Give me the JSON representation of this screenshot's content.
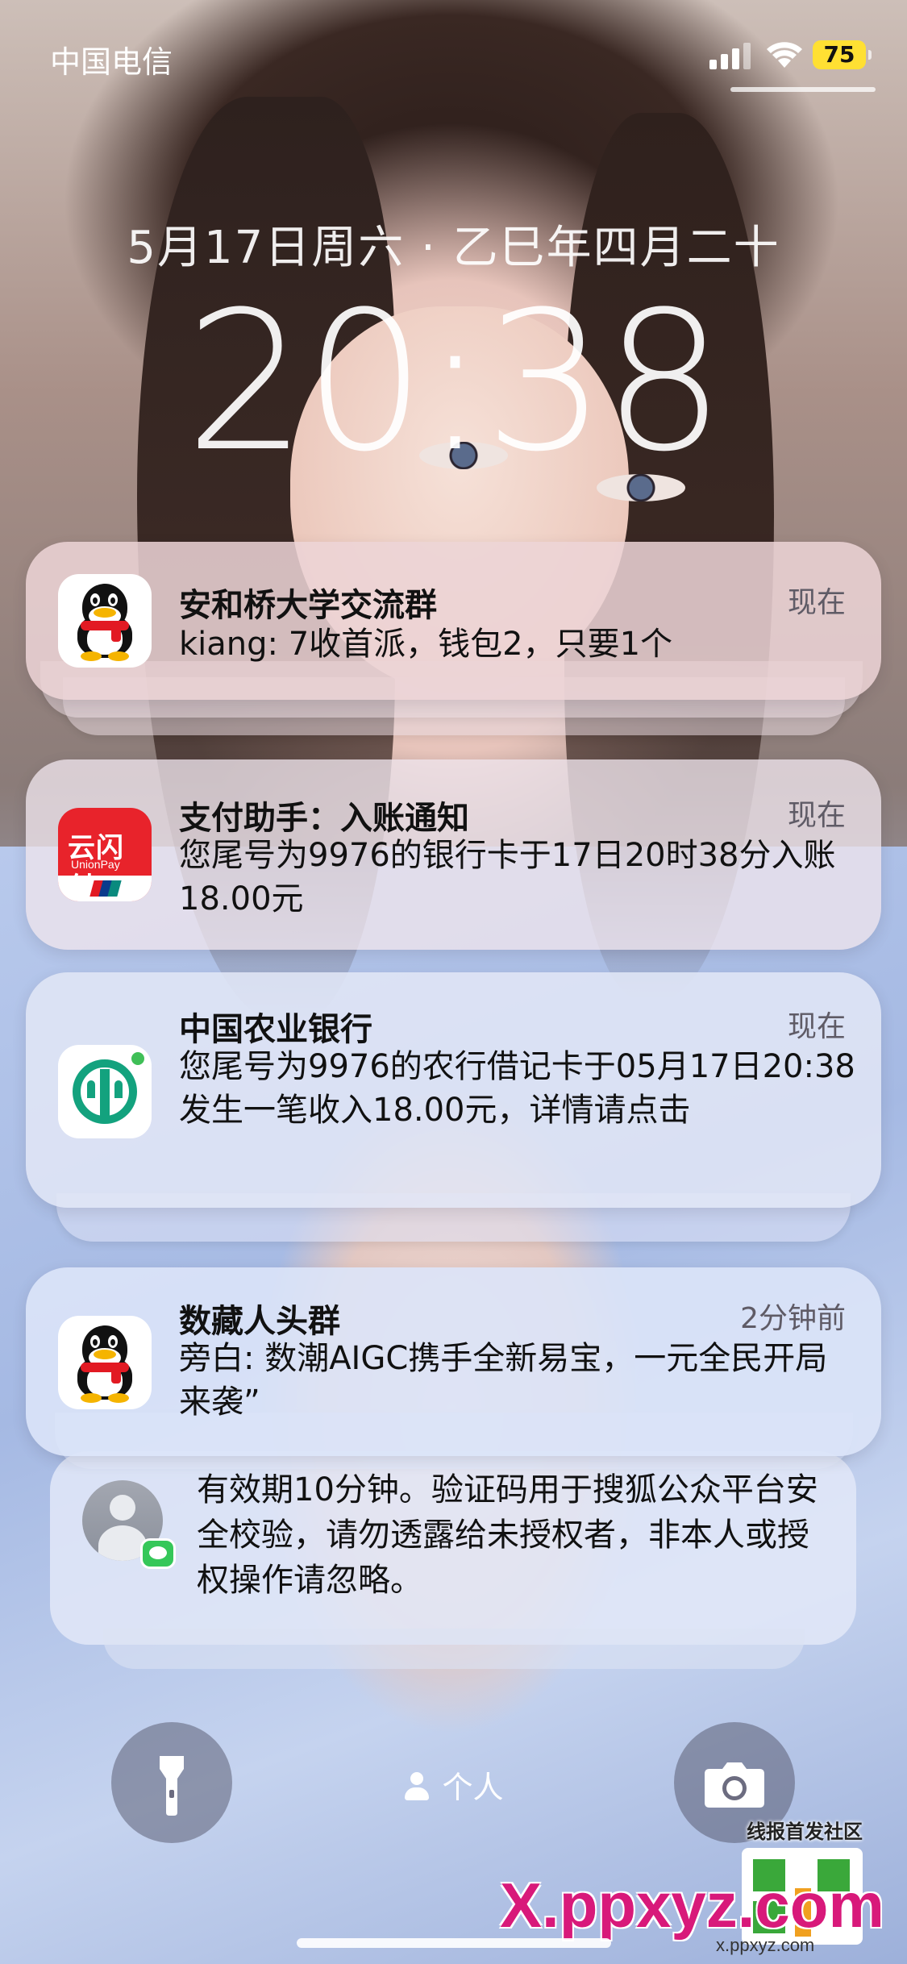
{
  "status_bar": {
    "carrier": "中国电信",
    "battery": "75",
    "battery_color": "#ffe033"
  },
  "lock": {
    "date": "5月17日周六 · 乙巳年四月二十",
    "time": "20:38"
  },
  "notifications": [
    {
      "app_icon": "qq-icon",
      "title": "安和桥大学交流群",
      "time": "现在",
      "body": "kiang: 7收首派，钱包2，只要1个"
    },
    {
      "app_icon": "unionpay-icon",
      "icon_text": "云闪付",
      "icon_sub": "UnionPay",
      "title": "支付助手：入账通知",
      "time": "现在",
      "body": "您尾号为9976的银行卡于17日20时38分入账18.00元"
    },
    {
      "app_icon": "abc-bank-icon",
      "title": "中国农业银行",
      "time": "现在",
      "body": "您尾号为9976的农行借记卡于05月17日20:38发生一笔收入18.00元，详情请点击"
    },
    {
      "app_icon": "qq-icon",
      "title": "数藏人头群",
      "time": "2分钟前",
      "body": "旁白: 数潮AIGC携手全新易宝，一元全民开局来袭”"
    }
  ],
  "sms_notification": {
    "app_icon": "messages-icon",
    "body": "有效期10分钟。验证码用于搜狐公众平台安全校验，请勿透露给未授权者，非本人或授权操作请忽略。"
  },
  "bottom": {
    "flashlight_icon": "flashlight-icon",
    "camera_icon": "camera-icon",
    "focus_label": "个人"
  },
  "watermark": {
    "line1": "线报首发社区",
    "main": "X.ppxyz.com",
    "small": "x.ppxyz.com"
  }
}
